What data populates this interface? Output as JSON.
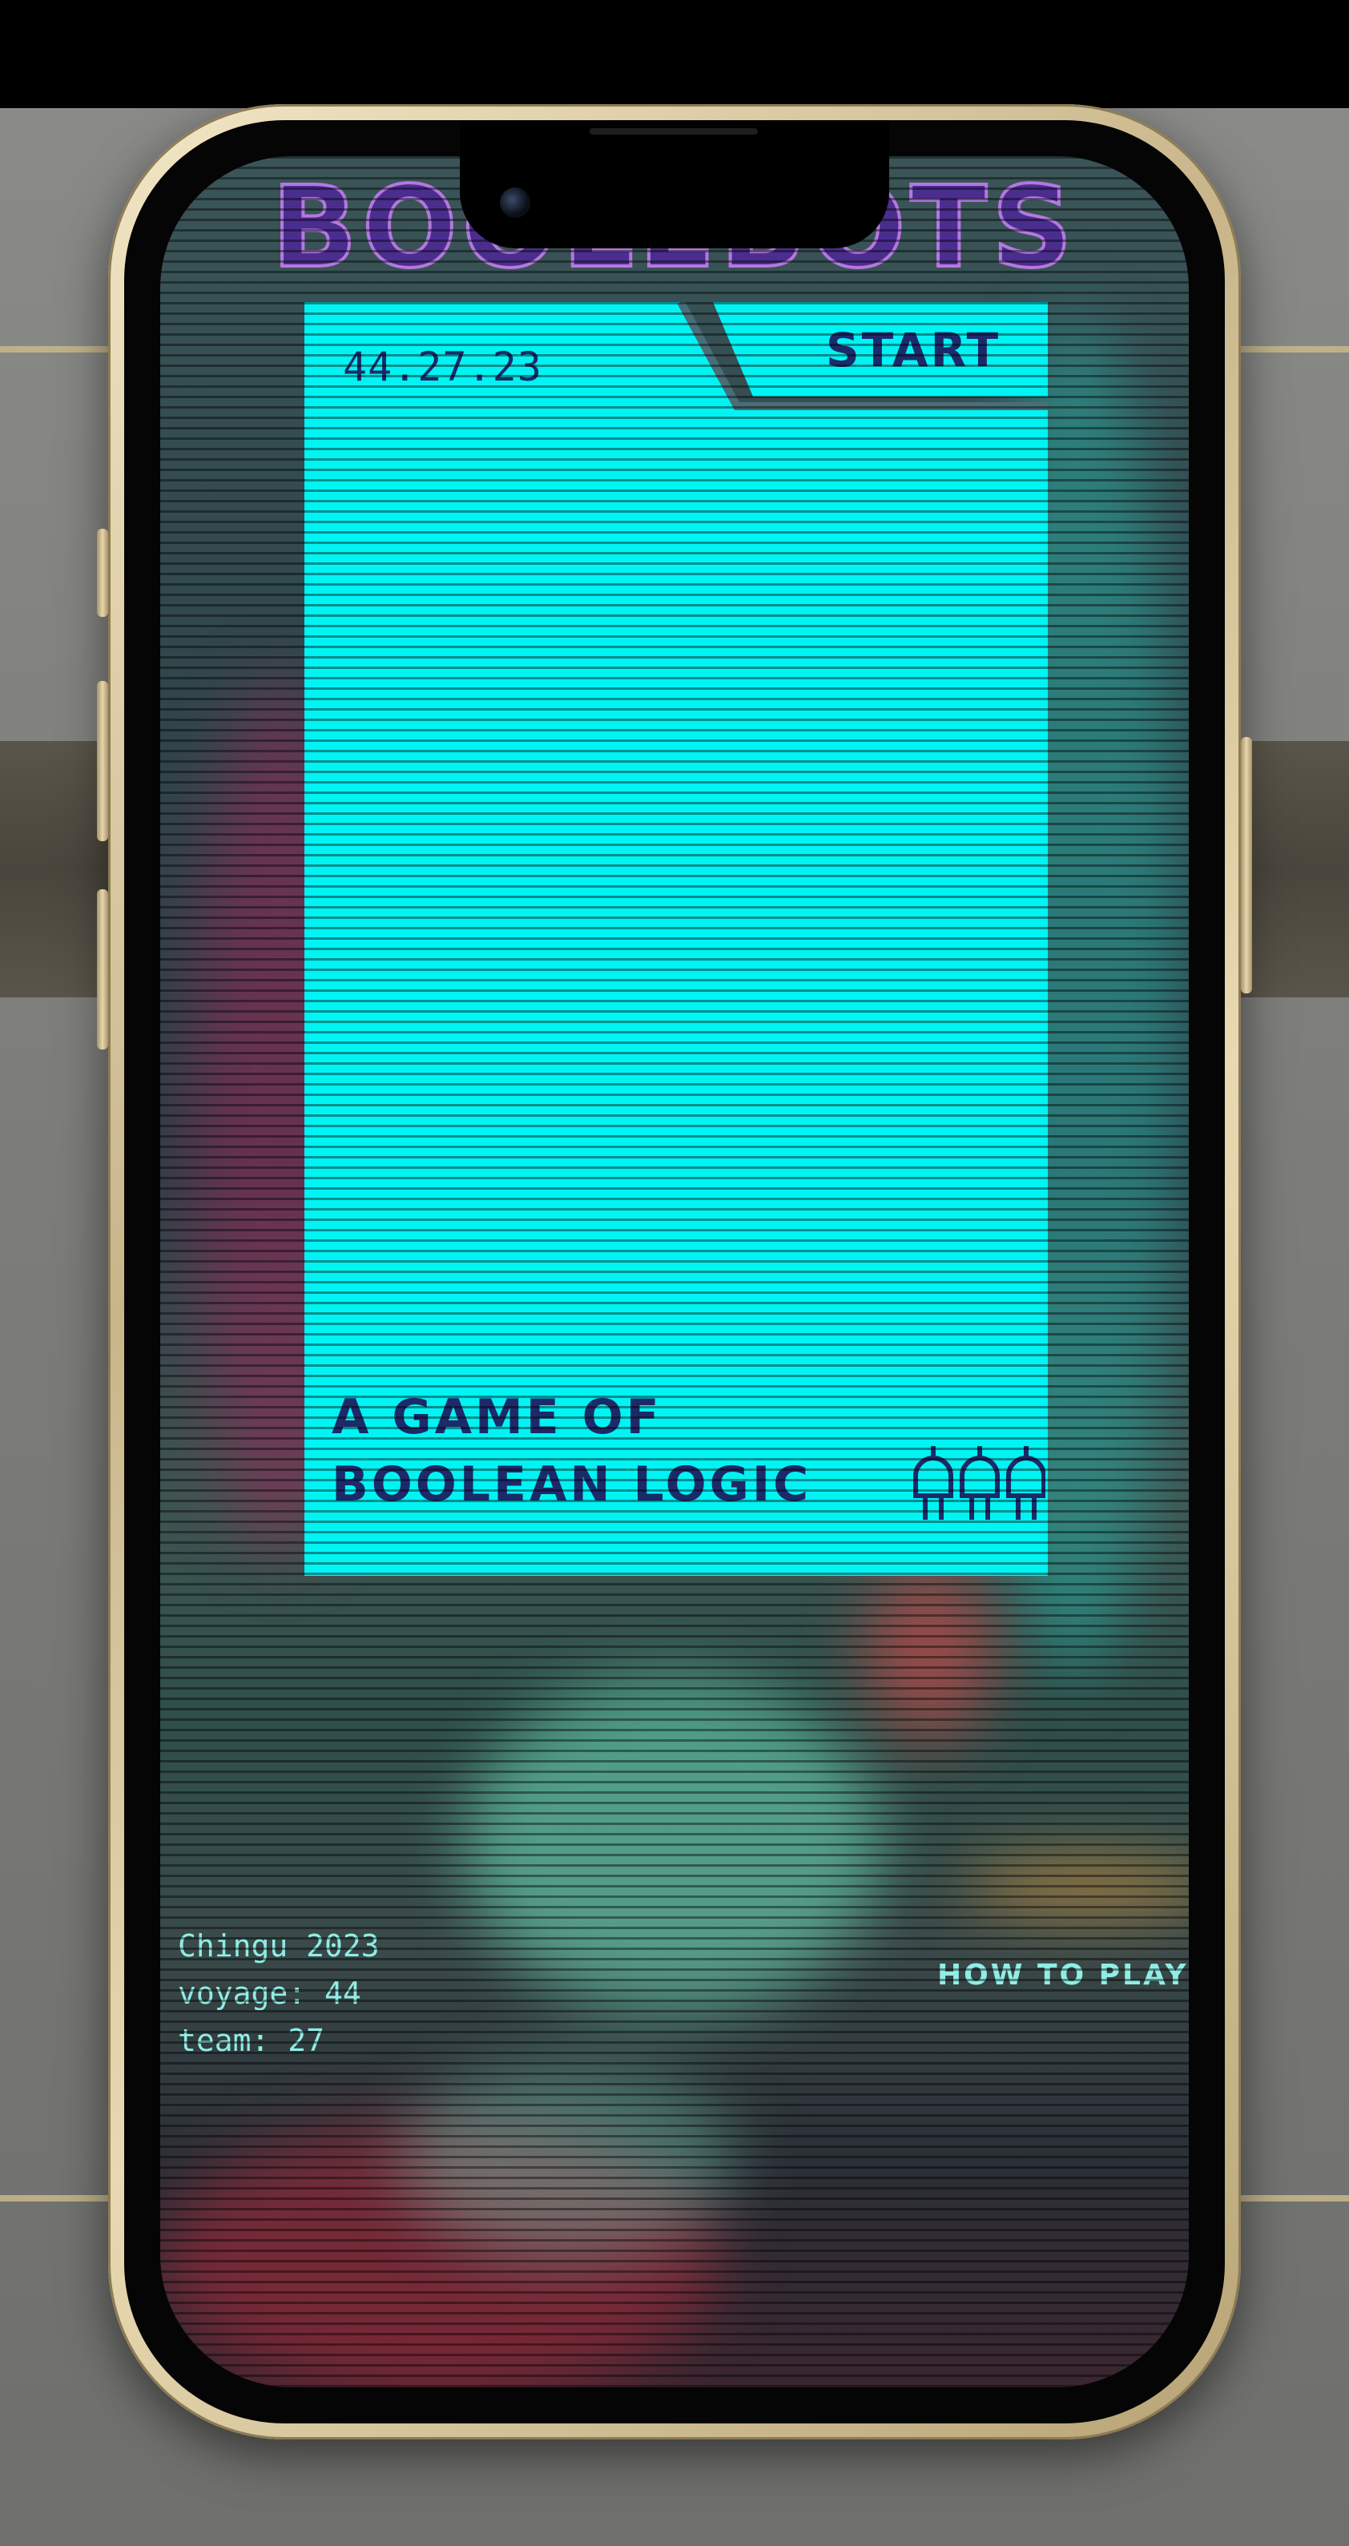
{
  "game": {
    "title": "BOOLEBOTS"
  },
  "card": {
    "date": "44.27.23",
    "start_label": "START",
    "tagline_line1": "A GAME OF",
    "tagline_line2": "BOOLEAN LOGIC",
    "bulb_icons": [
      "plug-icon",
      "plug-icon",
      "plug-icon"
    ]
  },
  "credits": {
    "line1": "Chingu 2023",
    "line2": "voyage: 44",
    "line3": "team: 27"
  },
  "footer": {
    "how_to_play_label": "HOW TO PLAY"
  },
  "colors": {
    "card": "#00f4f4",
    "card_text": "#1d2a6a",
    "title_fill": "#4b2d8f",
    "title_stroke": "#b478e0",
    "credit_text": "#8feee6"
  }
}
